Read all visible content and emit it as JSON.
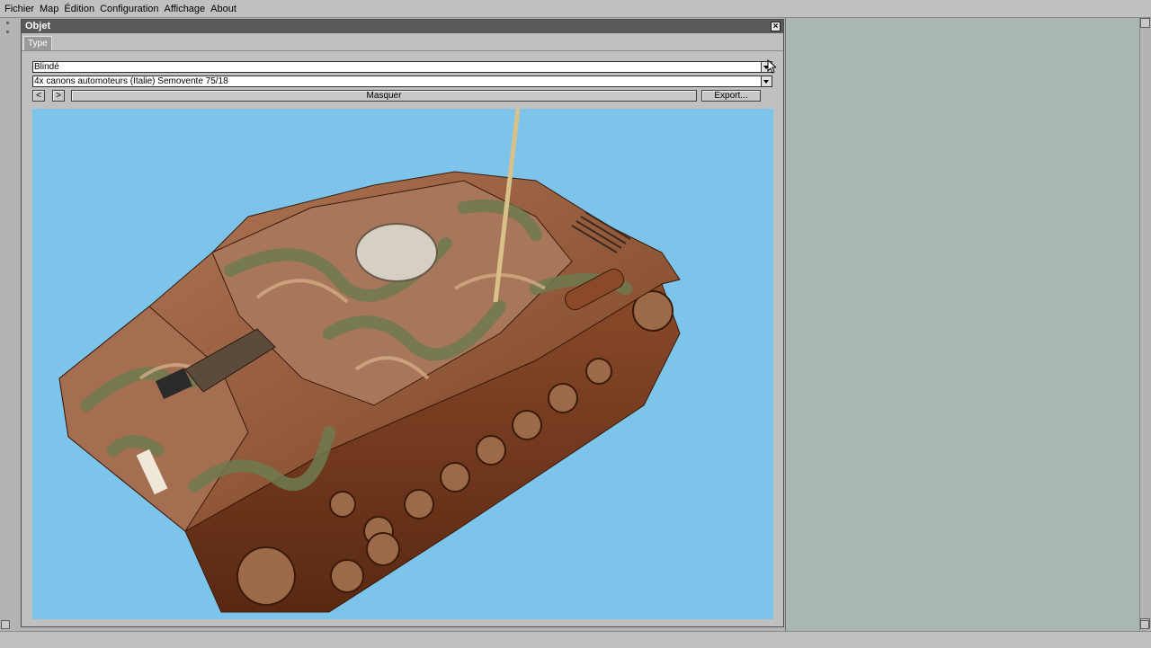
{
  "menu": [
    "Fichier",
    "Map",
    "Édition",
    "Configuration",
    "Affichage",
    "About"
  ],
  "dialog": {
    "title": "Objet",
    "tab": "Type",
    "category_select": "Blindé",
    "model_select": "4x canons automoteurs (Italie) Semovente 75/18",
    "prev_label": "<",
    "next_label": ">",
    "hide_label": "Masquer",
    "export_label": "Export...",
    "close_symbol": "×"
  },
  "viewport": {
    "background": "#7cc4ea",
    "object": "Semovente 75/18 3D model"
  },
  "icons": [
    "close-icon",
    "dropdown-arrow-icon",
    "mouse-cursor-icon",
    "scroll-arrow-icon"
  ]
}
